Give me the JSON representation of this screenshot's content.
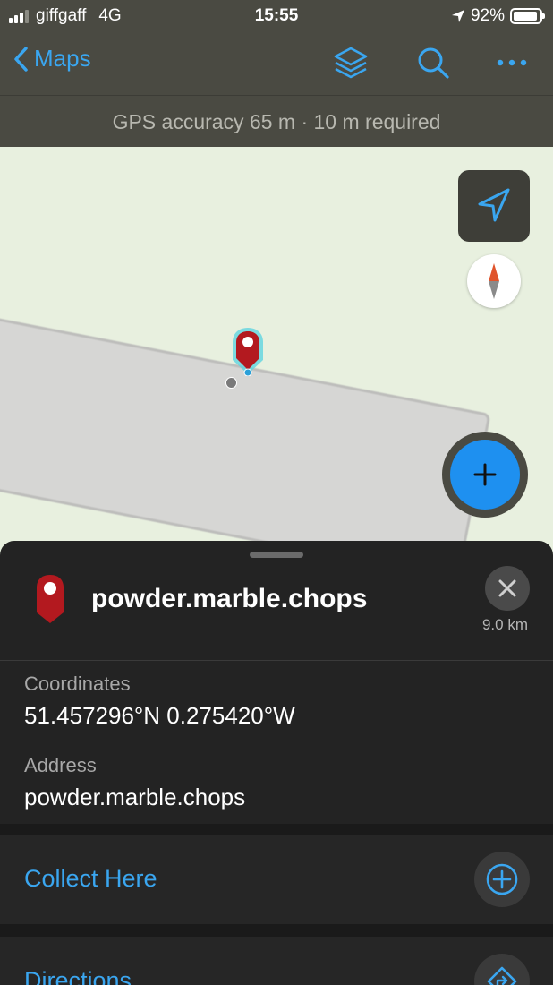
{
  "status_bar": {
    "carrier": "giffgaff",
    "network": "4G",
    "time": "15:55",
    "battery": "92%",
    "battery_level": 0.92
  },
  "nav": {
    "back_label": "Maps",
    "icons": [
      "layers-icon",
      "search-icon",
      "more-icon"
    ]
  },
  "gps": {
    "text": "GPS accuracy 65 m  ·  10 m required"
  },
  "map": {
    "controls": [
      "location-arrow-icon",
      "compass-icon",
      "add-icon"
    ]
  },
  "sheet": {
    "title": "powder.marble.chops",
    "distance": "9.0 km",
    "coordinates_label": "Coordinates",
    "coordinates_value": "51.457296°N  0.275420°W",
    "address_label": "Address",
    "address_value": "powder.marble.chops",
    "actions": [
      {
        "label": "Collect Here",
        "icon": "add-circle-icon"
      },
      {
        "label": "Directions",
        "icon": "directions-icon"
      }
    ]
  },
  "colors": {
    "accent": "#3aa6f0",
    "pin": "#b3191f",
    "bar": "#4a4a42",
    "sheet": "#232323",
    "fab": "#1e90f0"
  }
}
